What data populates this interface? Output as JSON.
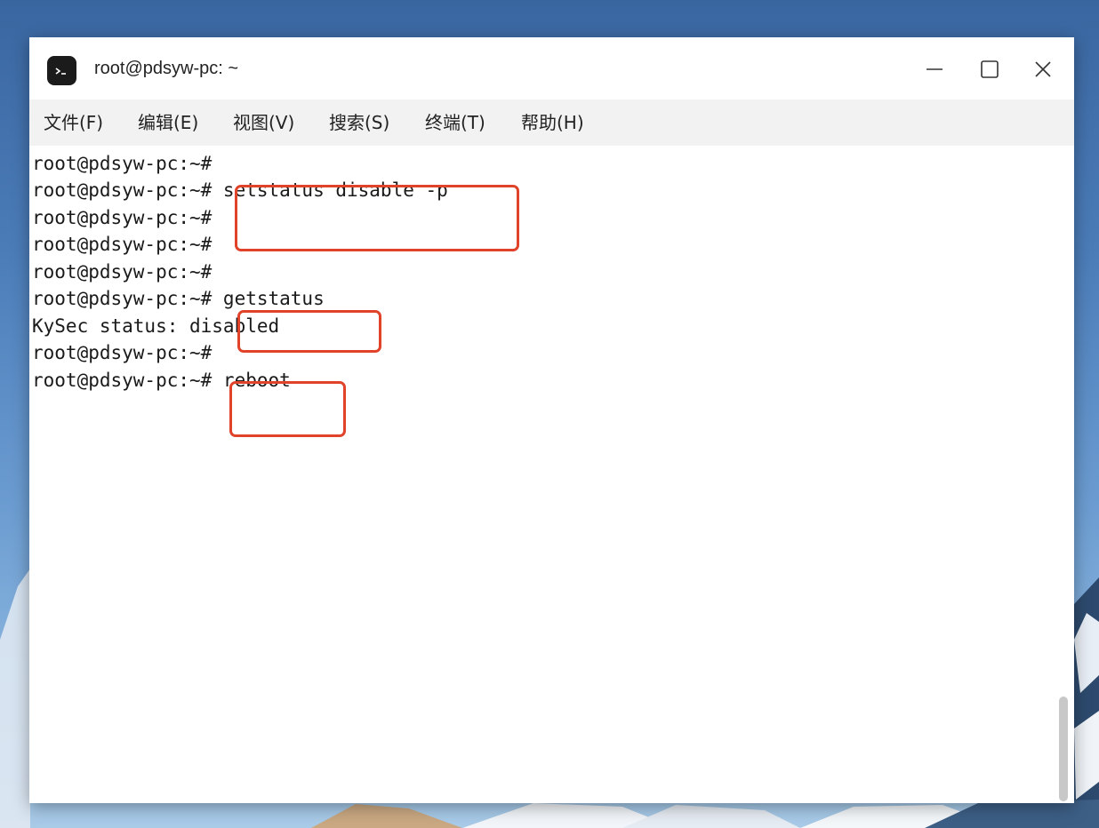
{
  "window": {
    "title": "root@pdsyw-pc: ~",
    "icon": "terminal-icon",
    "controls": [
      "minimize-icon",
      "maximize-icon",
      "close-icon"
    ]
  },
  "menu": [
    {
      "label": "文件(F)"
    },
    {
      "label": "编辑(E)"
    },
    {
      "label": "视图(V)"
    },
    {
      "label": "搜索(S)"
    },
    {
      "label": "终端(T)"
    },
    {
      "label": "帮助(H)"
    }
  ],
  "terminal": {
    "lines": [
      "root@pdsyw-pc:~#",
      "root@pdsyw-pc:~# setstatus disable -p",
      "root@pdsyw-pc:~#",
      "root@pdsyw-pc:~#",
      "root@pdsyw-pc:~#",
      "root@pdsyw-pc:~# getstatus",
      "KySec status: disabled",
      "root@pdsyw-pc:~#",
      "root@pdsyw-pc:~# reboot"
    ]
  },
  "colors": {
    "highlight": "#e0432a",
    "menubar": "#f2f2f2",
    "desktop": "#4b7cb8"
  }
}
